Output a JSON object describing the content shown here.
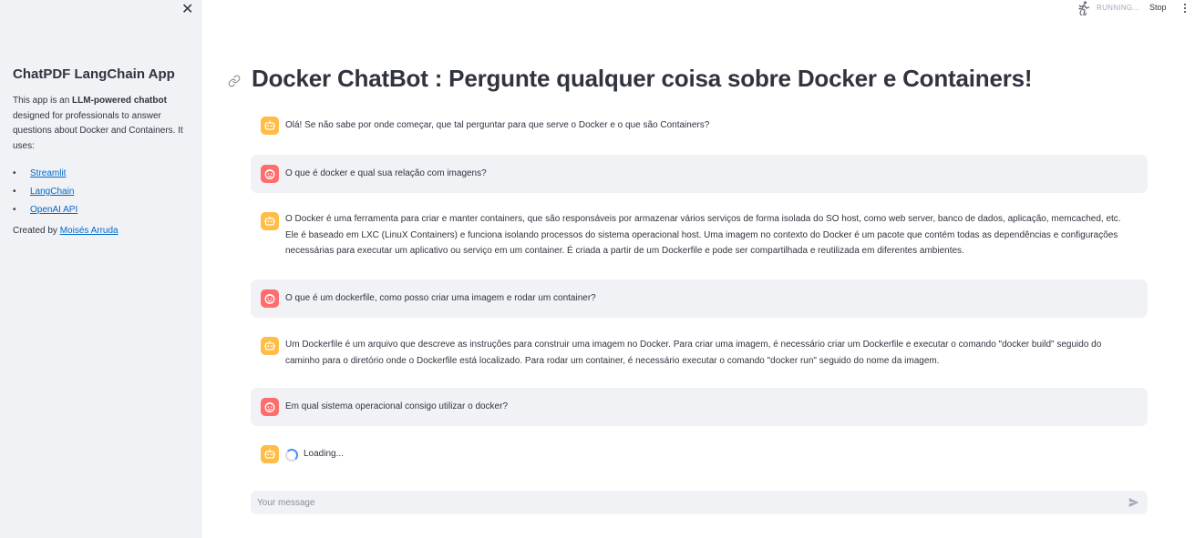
{
  "sidebar": {
    "title": "ChatPDF LangChain App",
    "desc_pre": "This app is an ",
    "desc_bold": "LLM-powered chatbot",
    "desc_post": " designed for professionals to answer questions about Docker and Containers. It uses:",
    "links": [
      "Streamlit",
      "LangChain",
      "OpenAI API"
    ],
    "credit_pre": "Created by ",
    "credit_link": "Moisés Arruda"
  },
  "topbar": {
    "status": "RUNNING...",
    "stop_label": "Stop"
  },
  "page": {
    "title": "Docker ChatBot : Pergunte qualquer coisa sobre Docker e Containers!"
  },
  "messages": [
    {
      "role": "assistant",
      "text": "Olá! Se não sabe por onde começar, que tal perguntar para que serve o Docker e o que são Containers?"
    },
    {
      "role": "user",
      "text": "O que é docker e qual sua relação com imagens?"
    },
    {
      "role": "assistant",
      "text": "O Docker é uma ferramenta para criar e manter containers, que são responsáveis por armazenar vários serviços de forma isolada do SO host, como web server, banco de dados, aplicação, memcached, etc. Ele é baseado em LXC (LinuX Containers) e funciona isolando processos do sistema operacional host. Uma imagem no contexto do Docker é um pacote que contém todas as dependências e configurações necessárias para executar um aplicativo ou serviço em um container. É criada a partir de um Dockerfile e pode ser compartilhada e reutilizada em diferentes ambientes."
    },
    {
      "role": "user",
      "text": "O que é um dockerfile, como posso criar uma imagem e rodar um container?"
    },
    {
      "role": "assistant",
      "text": "Um Dockerfile é um arquivo que descreve as instruções para construir uma imagem no Docker. Para criar uma imagem, é necessário criar um Dockerfile e executar o comando \"docker build\" seguido do caminho para o diretório onde o Dockerfile está localizado. Para rodar um container, é necessário executar o comando \"docker run\" seguido do nome da imagem."
    },
    {
      "role": "user",
      "text": "Em qual sistema operacional consigo utilizar o docker?"
    }
  ],
  "loading_text": "Loading...",
  "chat_input": {
    "placeholder": "Your message",
    "value": ""
  },
  "colors": {
    "sidebar_bg": "#f0f2f6",
    "bot_avatar": "#ffbd45",
    "user_avatar": "#ff6c6c",
    "link": "#0068c9"
  }
}
